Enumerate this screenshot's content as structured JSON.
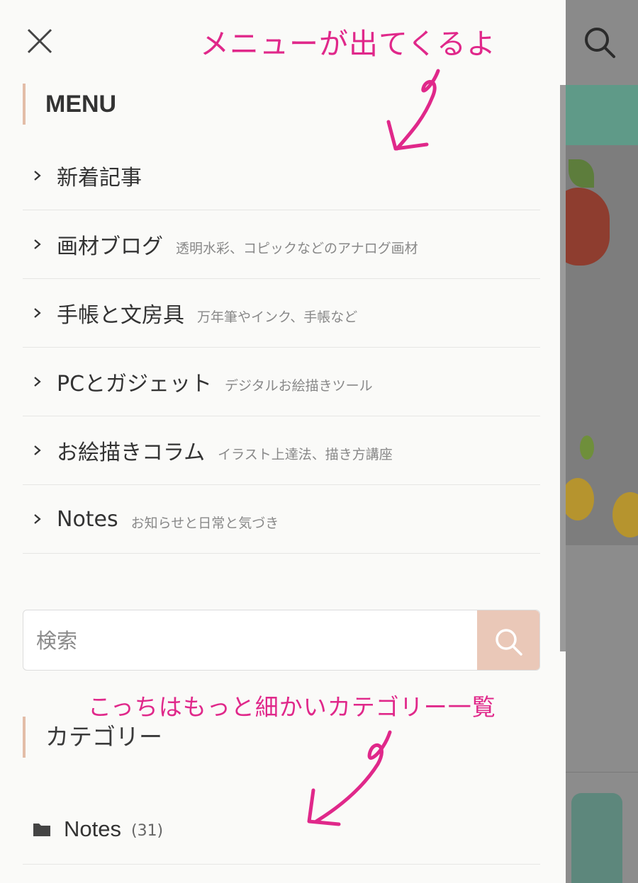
{
  "annotations": {
    "top": "メニューが出てくるよ",
    "bottom": "こっちはもっと細かいカテゴリー一覧"
  },
  "menu": {
    "heading": "MENU",
    "items": [
      {
        "label": "新着記事",
        "sub": ""
      },
      {
        "label": "画材ブログ",
        "sub": "透明水彩、コピックなどのアナログ画材"
      },
      {
        "label": "手帳と文房具",
        "sub": "万年筆やインク、手帳など"
      },
      {
        "label": "PCとガジェット",
        "sub": "デジタルお絵描きツール"
      },
      {
        "label": "お絵描きコラム",
        "sub": "イラスト上達法、描き方講座"
      },
      {
        "label": "Notes",
        "sub": "お知らせと日常と気づき"
      }
    ]
  },
  "search": {
    "placeholder": "検索"
  },
  "categories": {
    "heading": "カテゴリー",
    "items": [
      {
        "label": "Notes",
        "count": "(31)"
      }
    ]
  },
  "colors": {
    "annotation": "#e0288a",
    "accent": "#e3bda8",
    "search_button": "#eac8b8"
  },
  "icons": {
    "close": "close-icon",
    "search": "search-icon",
    "chevron": "chevron-right-icon",
    "folder": "folder-icon"
  }
}
